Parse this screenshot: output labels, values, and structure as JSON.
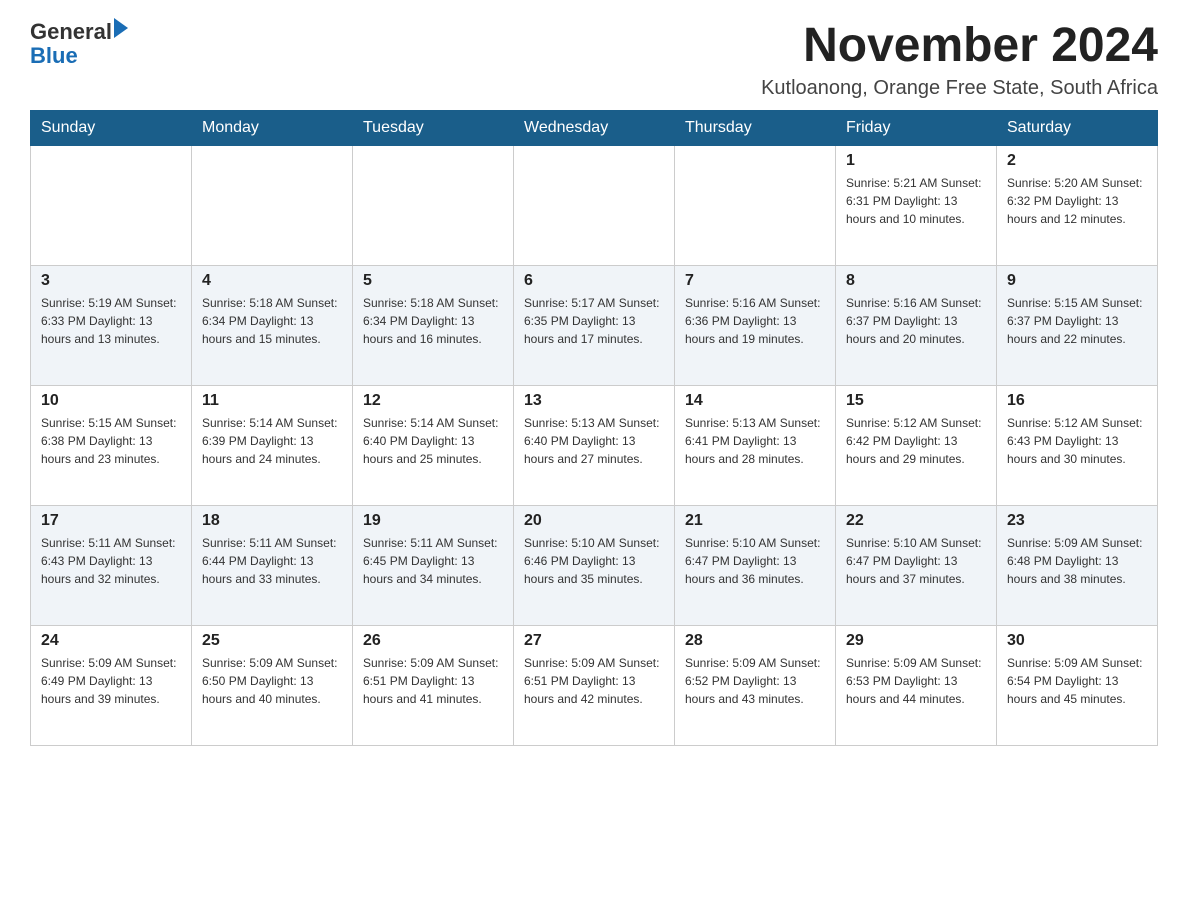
{
  "header": {
    "logo_general": "General",
    "logo_blue": "Blue",
    "month_title": "November 2024",
    "location": "Kutloanong, Orange Free State, South Africa"
  },
  "weekdays": [
    "Sunday",
    "Monday",
    "Tuesday",
    "Wednesday",
    "Thursday",
    "Friday",
    "Saturday"
  ],
  "weeks": [
    [
      {
        "day": "",
        "info": ""
      },
      {
        "day": "",
        "info": ""
      },
      {
        "day": "",
        "info": ""
      },
      {
        "day": "",
        "info": ""
      },
      {
        "day": "",
        "info": ""
      },
      {
        "day": "1",
        "info": "Sunrise: 5:21 AM\nSunset: 6:31 PM\nDaylight: 13 hours\nand 10 minutes."
      },
      {
        "day": "2",
        "info": "Sunrise: 5:20 AM\nSunset: 6:32 PM\nDaylight: 13 hours\nand 12 minutes."
      }
    ],
    [
      {
        "day": "3",
        "info": "Sunrise: 5:19 AM\nSunset: 6:33 PM\nDaylight: 13 hours\nand 13 minutes."
      },
      {
        "day": "4",
        "info": "Sunrise: 5:18 AM\nSunset: 6:34 PM\nDaylight: 13 hours\nand 15 minutes."
      },
      {
        "day": "5",
        "info": "Sunrise: 5:18 AM\nSunset: 6:34 PM\nDaylight: 13 hours\nand 16 minutes."
      },
      {
        "day": "6",
        "info": "Sunrise: 5:17 AM\nSunset: 6:35 PM\nDaylight: 13 hours\nand 17 minutes."
      },
      {
        "day": "7",
        "info": "Sunrise: 5:16 AM\nSunset: 6:36 PM\nDaylight: 13 hours\nand 19 minutes."
      },
      {
        "day": "8",
        "info": "Sunrise: 5:16 AM\nSunset: 6:37 PM\nDaylight: 13 hours\nand 20 minutes."
      },
      {
        "day": "9",
        "info": "Sunrise: 5:15 AM\nSunset: 6:37 PM\nDaylight: 13 hours\nand 22 minutes."
      }
    ],
    [
      {
        "day": "10",
        "info": "Sunrise: 5:15 AM\nSunset: 6:38 PM\nDaylight: 13 hours\nand 23 minutes."
      },
      {
        "day": "11",
        "info": "Sunrise: 5:14 AM\nSunset: 6:39 PM\nDaylight: 13 hours\nand 24 minutes."
      },
      {
        "day": "12",
        "info": "Sunrise: 5:14 AM\nSunset: 6:40 PM\nDaylight: 13 hours\nand 25 minutes."
      },
      {
        "day": "13",
        "info": "Sunrise: 5:13 AM\nSunset: 6:40 PM\nDaylight: 13 hours\nand 27 minutes."
      },
      {
        "day": "14",
        "info": "Sunrise: 5:13 AM\nSunset: 6:41 PM\nDaylight: 13 hours\nand 28 minutes."
      },
      {
        "day": "15",
        "info": "Sunrise: 5:12 AM\nSunset: 6:42 PM\nDaylight: 13 hours\nand 29 minutes."
      },
      {
        "day": "16",
        "info": "Sunrise: 5:12 AM\nSunset: 6:43 PM\nDaylight: 13 hours\nand 30 minutes."
      }
    ],
    [
      {
        "day": "17",
        "info": "Sunrise: 5:11 AM\nSunset: 6:43 PM\nDaylight: 13 hours\nand 32 minutes."
      },
      {
        "day": "18",
        "info": "Sunrise: 5:11 AM\nSunset: 6:44 PM\nDaylight: 13 hours\nand 33 minutes."
      },
      {
        "day": "19",
        "info": "Sunrise: 5:11 AM\nSunset: 6:45 PM\nDaylight: 13 hours\nand 34 minutes."
      },
      {
        "day": "20",
        "info": "Sunrise: 5:10 AM\nSunset: 6:46 PM\nDaylight: 13 hours\nand 35 minutes."
      },
      {
        "day": "21",
        "info": "Sunrise: 5:10 AM\nSunset: 6:47 PM\nDaylight: 13 hours\nand 36 minutes."
      },
      {
        "day": "22",
        "info": "Sunrise: 5:10 AM\nSunset: 6:47 PM\nDaylight: 13 hours\nand 37 minutes."
      },
      {
        "day": "23",
        "info": "Sunrise: 5:09 AM\nSunset: 6:48 PM\nDaylight: 13 hours\nand 38 minutes."
      }
    ],
    [
      {
        "day": "24",
        "info": "Sunrise: 5:09 AM\nSunset: 6:49 PM\nDaylight: 13 hours\nand 39 minutes."
      },
      {
        "day": "25",
        "info": "Sunrise: 5:09 AM\nSunset: 6:50 PM\nDaylight: 13 hours\nand 40 minutes."
      },
      {
        "day": "26",
        "info": "Sunrise: 5:09 AM\nSunset: 6:51 PM\nDaylight: 13 hours\nand 41 minutes."
      },
      {
        "day": "27",
        "info": "Sunrise: 5:09 AM\nSunset: 6:51 PM\nDaylight: 13 hours\nand 42 minutes."
      },
      {
        "day": "28",
        "info": "Sunrise: 5:09 AM\nSunset: 6:52 PM\nDaylight: 13 hours\nand 43 minutes."
      },
      {
        "day": "29",
        "info": "Sunrise: 5:09 AM\nSunset: 6:53 PM\nDaylight: 13 hours\nand 44 minutes."
      },
      {
        "day": "30",
        "info": "Sunrise: 5:09 AM\nSunset: 6:54 PM\nDaylight: 13 hours\nand 45 minutes."
      }
    ]
  ]
}
